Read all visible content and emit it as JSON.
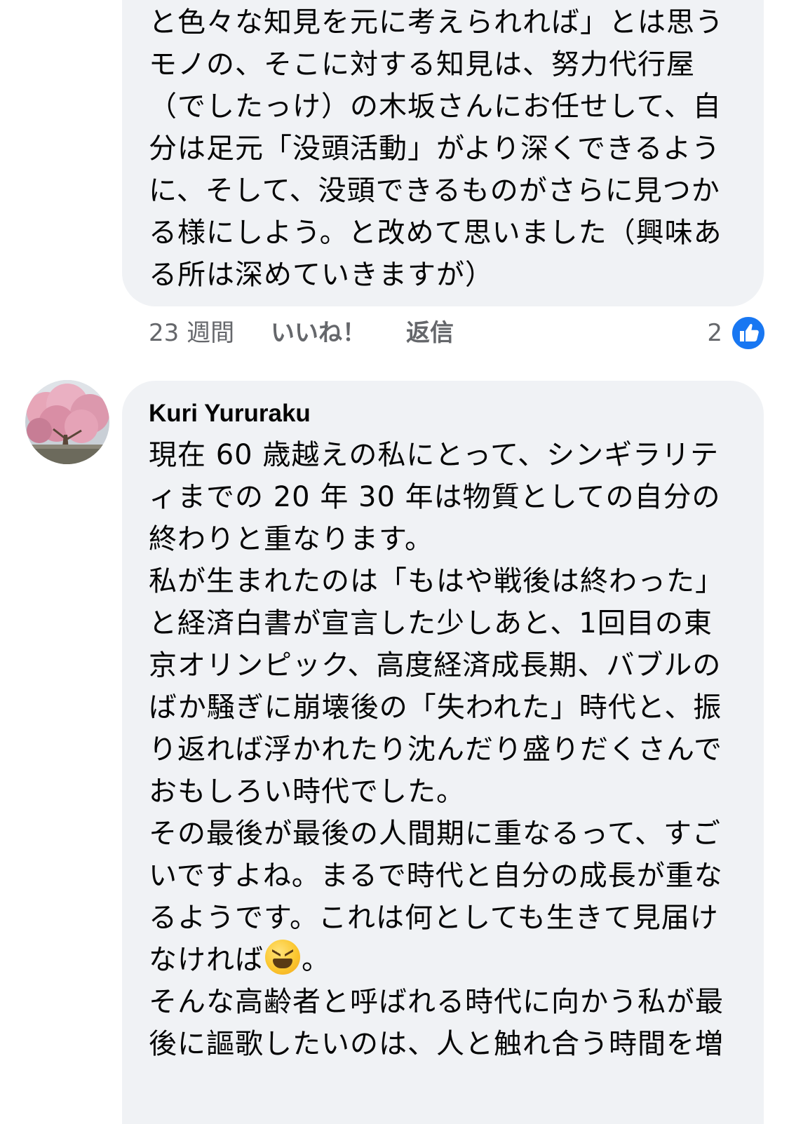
{
  "comment_1": {
    "text": "と色々な知見を元に考えられれば」とは思う\nモノの、そこに対する知見は、努力代行屋\n（でしたっけ）の木坂さんにお任せして、自\n分は足元「没頭活動」がより深くできるよう\nに、そして、没頭できるものがさらに見つか\nる様にしよう。と改めて思いました（興味あ\nる所は深めていきますが）",
    "time": "23 週間",
    "like_label": "いいね！",
    "reply_label": "返信",
    "like_count": "2",
    "like_icon": "thumbs-up-icon",
    "accent_color": "#1877f2"
  },
  "comment_2": {
    "author": "Kuri Yururaku",
    "avatar": "cherry-blossom-avatar",
    "text_before_emoji": "現在 60 歳越えの私にとって、シンギラリテ\nィまでの 20 年 30 年は物質としての自分の\n終わりと重なります。\n私が生まれたのは「もはや戦後は終わった」\nと経済白書が宣言した少しあと、1回目の東\n京オリンピック、高度経済成長期、バブルの\nばか騒ぎに崩壊後の「失われた」時代と、振\nり返れば浮かれたり沈んだり盛りだくさんで\nおもしろい時代でした。\nその最後が最後の人間期に重なるって、すご\nいですよね。まるで時代と自分の成長が重な\nるようです。これは何としても生きて見届け\nなければ",
    "emoji": "laughing-face-emoji",
    "text_after_emoji": "。\nそんな高齢者と呼ばれる時代に向かう私が最\n後に謳歌したいのは、人と触れ合う時間を増"
  }
}
